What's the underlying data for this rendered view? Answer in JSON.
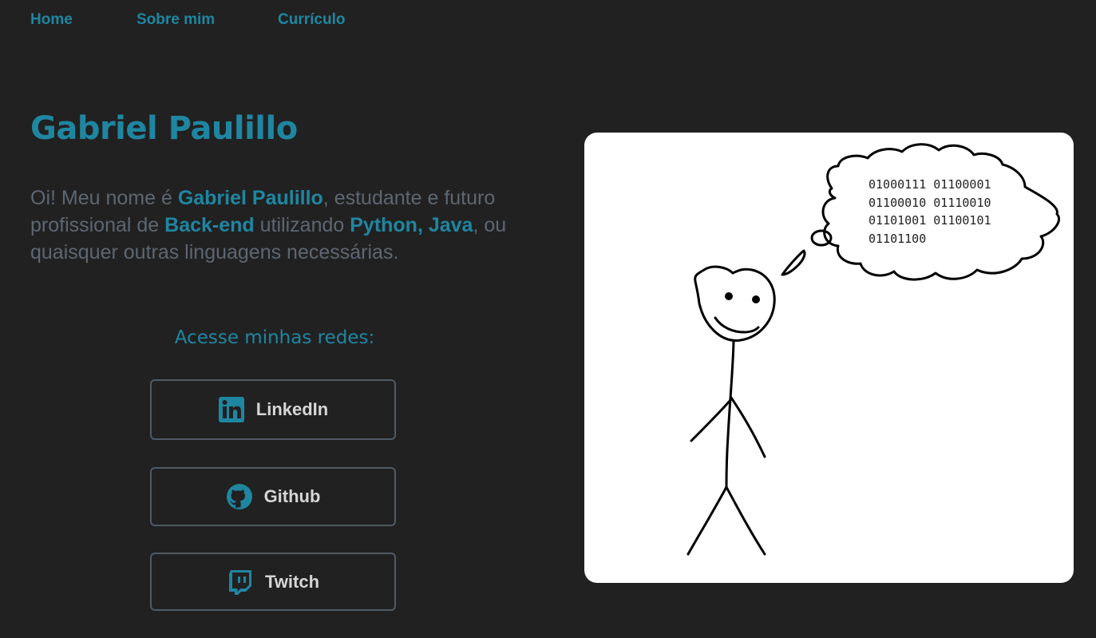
{
  "nav": {
    "home": "Home",
    "about": "Sobre mim",
    "resume": "Currículo"
  },
  "hero": {
    "name": "Gabriel Paulillo",
    "intro": {
      "p1": "Oi! Meu nome é ",
      "name": "Gabriel Paulillo",
      "p2": ", estudante e futuro profissional de ",
      "role": "Back-end",
      "p3": " utilizando ",
      "langs": "Python, Java",
      "p4": ", ou quaisquer outras linguagens necessárias."
    }
  },
  "networks": {
    "title": "Acesse minhas redes:",
    "buttons": [
      {
        "label": "LinkedIn",
        "icon": "linkedin-icon"
      },
      {
        "label": "Github",
        "icon": "github-icon"
      },
      {
        "label": "Twitch",
        "icon": "twitch-icon"
      }
    ]
  },
  "illustration": {
    "binary_lines": [
      "01000111 01100001",
      "01100010 01110010",
      "01101001 01100101",
      "01101100"
    ]
  },
  "colors": {
    "background": "#212121",
    "accent": "#1f86a1",
    "text_muted": "#5d6773",
    "button_border": "#4e5a66",
    "button_text": "#d6d6d6"
  }
}
